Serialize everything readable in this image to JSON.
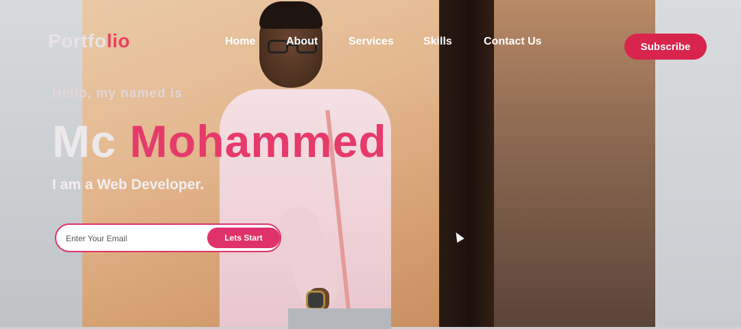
{
  "brand": {
    "logo_part1": "Portfo",
    "logo_part2": "lio",
    "accent_color": "#e0326a"
  },
  "nav": {
    "items": [
      {
        "label": "Home"
      },
      {
        "label": "About"
      },
      {
        "label": "Services"
      },
      {
        "label": "Skills"
      },
      {
        "label": "Contact Us"
      }
    ],
    "subscribe_label": "Subscribe"
  },
  "hero": {
    "greeting": "Hello, my named is",
    "first_name": "Mc",
    "last_name": "Mohammed",
    "role": "I am a Web Developer.",
    "email_placeholder": "Enter Your Email",
    "cta_label": "Lets Start"
  },
  "icons": {
    "cursor": "mouse-pointer-icon"
  }
}
